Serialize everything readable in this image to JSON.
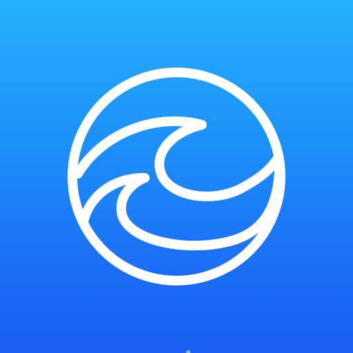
{
  "app": {
    "name": "",
    "icon": "wave-in-circle-icon",
    "colors": {
      "background_top": "#25b0fb",
      "background_bottom": "#1b5ff2",
      "emblem": "#ffffff"
    }
  }
}
